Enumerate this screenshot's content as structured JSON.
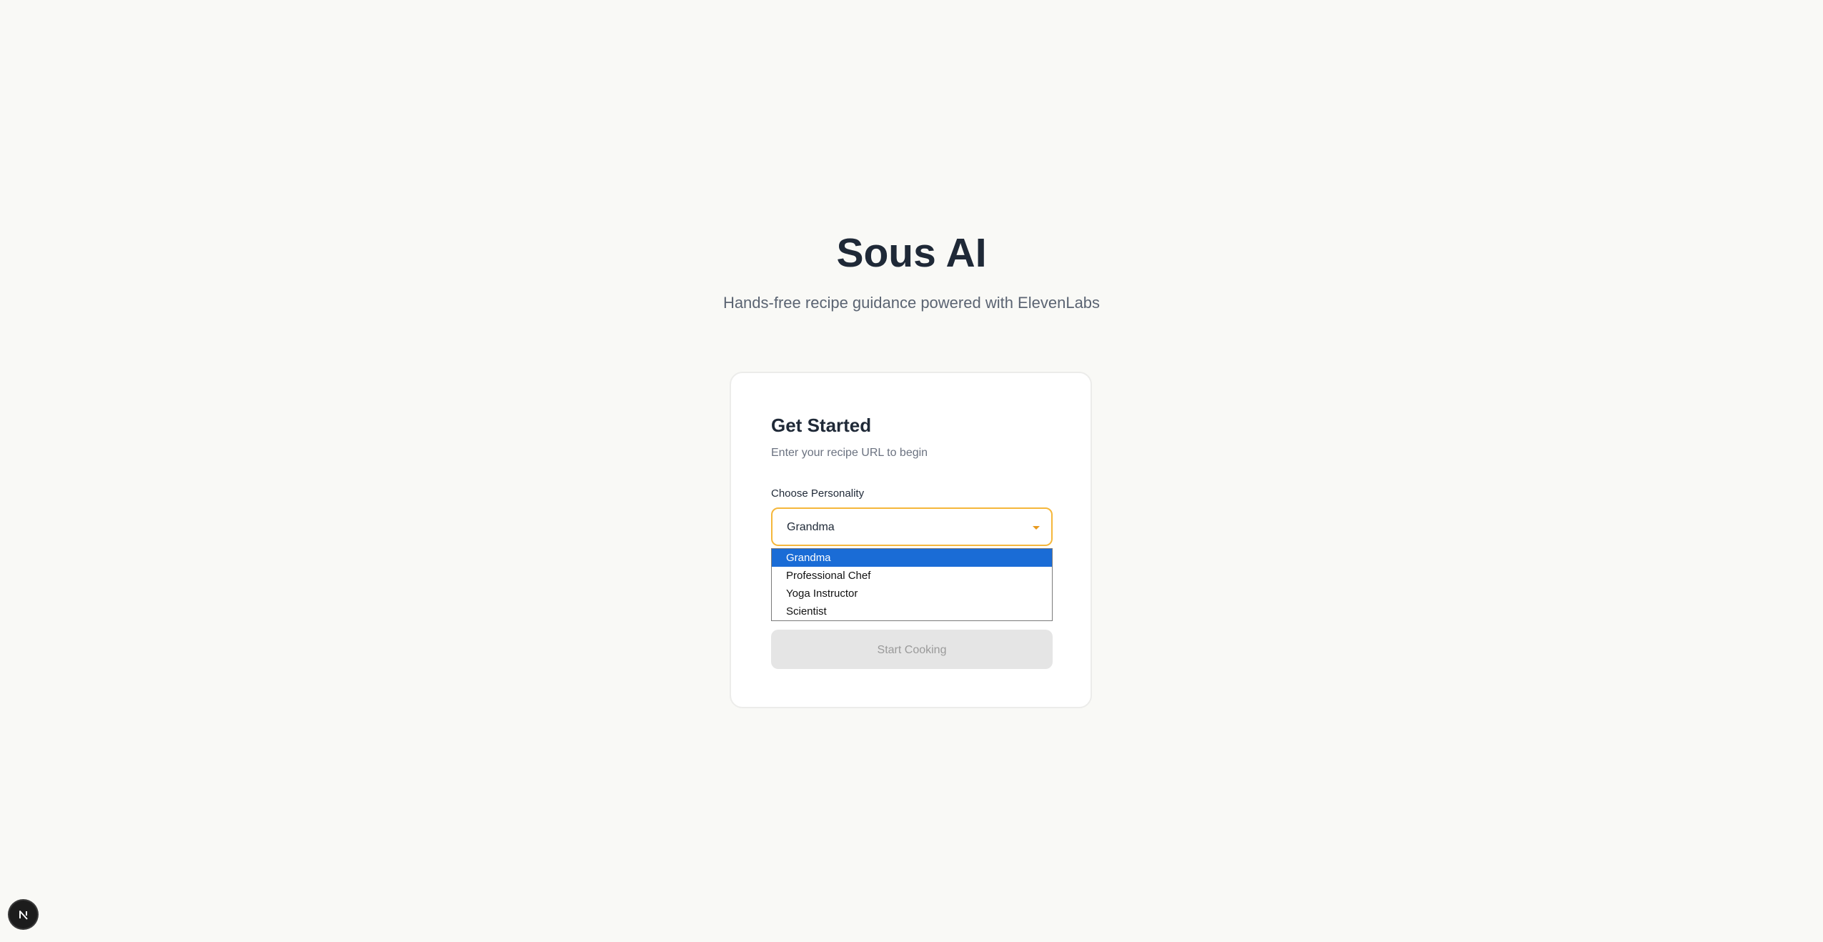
{
  "app": {
    "title": "Sous AI",
    "subtitle": "Hands-free recipe guidance powered with ElevenLabs"
  },
  "card": {
    "title": "Get Started",
    "description": "Enter your recipe URL to begin",
    "personality_label": "Choose Personality",
    "personality_selected": "Grandma",
    "personality_options": [
      "Grandma",
      "Professional Chef",
      "Yoga Instructor",
      "Scientist"
    ],
    "start_button_label": "Start Cooking"
  },
  "badge": {
    "icon": "nextjs-logo-icon"
  },
  "colors": {
    "background": "#f9f9f6",
    "accent_border": "#f5b73b",
    "caret": "#e89a1f",
    "selected_option": "#1a6cd6",
    "disabled_button": "#e5e5e5"
  }
}
